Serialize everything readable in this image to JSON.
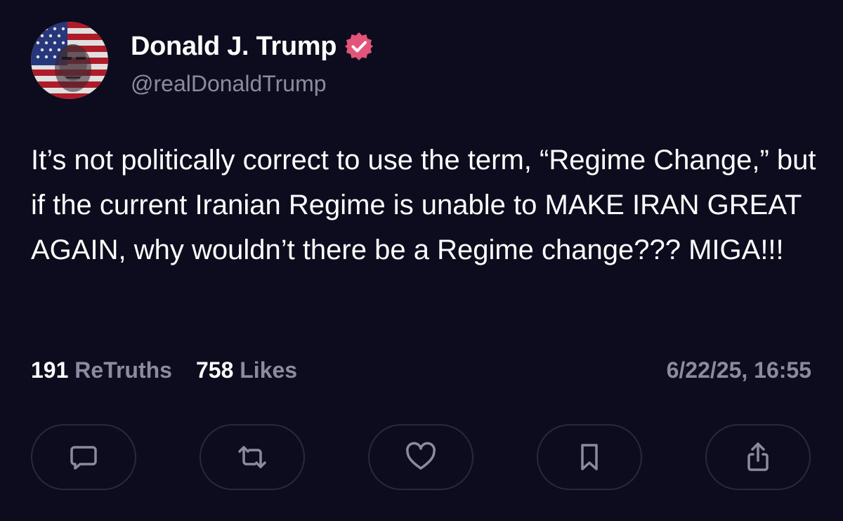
{
  "author": {
    "name": "Donald J. Trump",
    "handle": "@realDonaldTrump",
    "verified": true,
    "avatar_icon": "flag-portrait-avatar"
  },
  "post": {
    "text": "It’s not politically correct to use the term, “Regime Change,” but if the current Iranian Regime is unable to MAKE IRAN GREAT AGAIN, why wouldn’t there be a Regime change??? MIGA!!!"
  },
  "stats": {
    "retruths_count": "191",
    "retruths_label": "ReTruths",
    "likes_count": "758",
    "likes_label": "Likes"
  },
  "timestamp": "6/22/25, 16:55",
  "actions": [
    {
      "name": "reply",
      "icon": "comment-icon"
    },
    {
      "name": "retruth",
      "icon": "repost-icon"
    },
    {
      "name": "like",
      "icon": "heart-icon"
    },
    {
      "name": "bookmark",
      "icon": "bookmark-icon"
    },
    {
      "name": "share",
      "icon": "share-icon"
    }
  ],
  "colors": {
    "background": "#0d0b1e",
    "text": "#ffffff",
    "muted": "#8c8a9c",
    "verified": "#e3547a",
    "button_border": "#2a2840"
  }
}
